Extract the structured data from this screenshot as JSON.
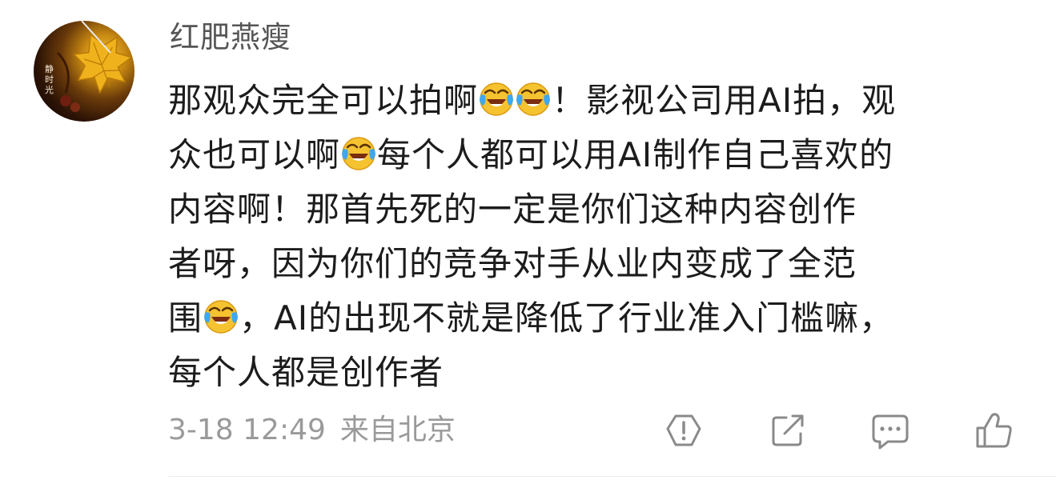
{
  "comment": {
    "username": "红肥燕瘦",
    "avatar_text": "静时光",
    "lines": [
      [
        "那观众完全可以拍啊",
        {
          "emoji": "laughing-crying-emoji"
        },
        {
          "emoji": "laughing-crying-emoji"
        },
        "！影视公司用AI拍，观"
      ],
      [
        "众也可以啊",
        {
          "emoji": "laughing-crying-emoji"
        },
        "每个人都可以用AI制作自己喜欢的"
      ],
      [
        "内容啊！那首先死的一定是你们这种内容创作"
      ],
      [
        "者呀，因为你们的竞争对手从业内变成了全范"
      ],
      [
        "围",
        {
          "emoji": "laughing-crying-emoji"
        },
        "，AI的出现不就是降低了行业准入门槛嘛，"
      ],
      [
        "每个人都是创作者"
      ]
    ],
    "time": "3-18 12:49",
    "location": "来自北京"
  },
  "actions": {
    "report_icon": "exclamation-shield-icon",
    "share_icon": "share-arrow-icon",
    "reply_icon": "speech-bubble-icon",
    "like_icon": "thumbs-up-icon"
  },
  "colors": {
    "username": "#555555",
    "content": "#1c1c1c",
    "meta": "#9a9a9a",
    "icon": "#8a8a8a",
    "divider": "#ececec"
  }
}
